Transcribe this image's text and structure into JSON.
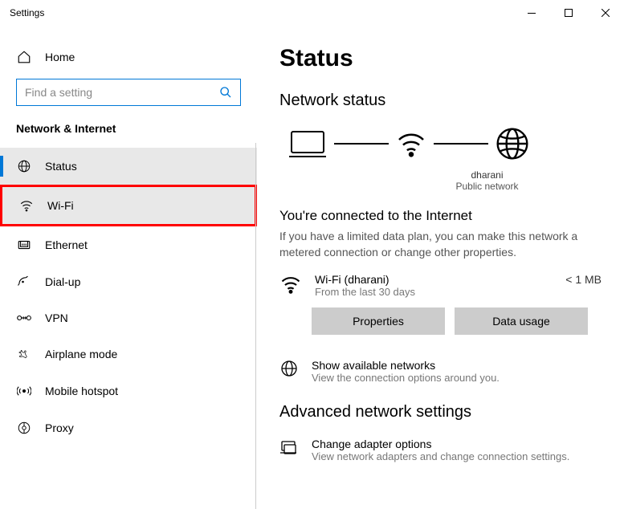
{
  "window": {
    "title": "Settings"
  },
  "sidebar": {
    "home": "Home",
    "search_placeholder": "Find a setting",
    "category": "Network & Internet",
    "items": [
      {
        "label": "Status"
      },
      {
        "label": "Wi-Fi"
      },
      {
        "label": "Ethernet"
      },
      {
        "label": "Dial-up"
      },
      {
        "label": "VPN"
      },
      {
        "label": "Airplane mode"
      },
      {
        "label": "Mobile hotspot"
      },
      {
        "label": "Proxy"
      }
    ]
  },
  "main": {
    "title": "Status",
    "network_status": "Network status",
    "diagram": {
      "network_name": "dharani",
      "network_type": "Public network"
    },
    "connected": {
      "title": "You're connected to the Internet",
      "desc": "If you have a limited data plan, you can make this network a metered connection or change other properties."
    },
    "connection": {
      "name": "Wi-Fi (dharani)",
      "sub": "From the last 30 days",
      "usage": "< 1 MB"
    },
    "buttons": {
      "properties": "Properties",
      "data_usage": "Data usage"
    },
    "available": {
      "title": "Show available networks",
      "sub": "View the connection options around you."
    },
    "advanced": {
      "title": "Advanced network settings",
      "adapter": {
        "title": "Change adapter options",
        "sub": "View network adapters and change connection settings."
      }
    }
  }
}
